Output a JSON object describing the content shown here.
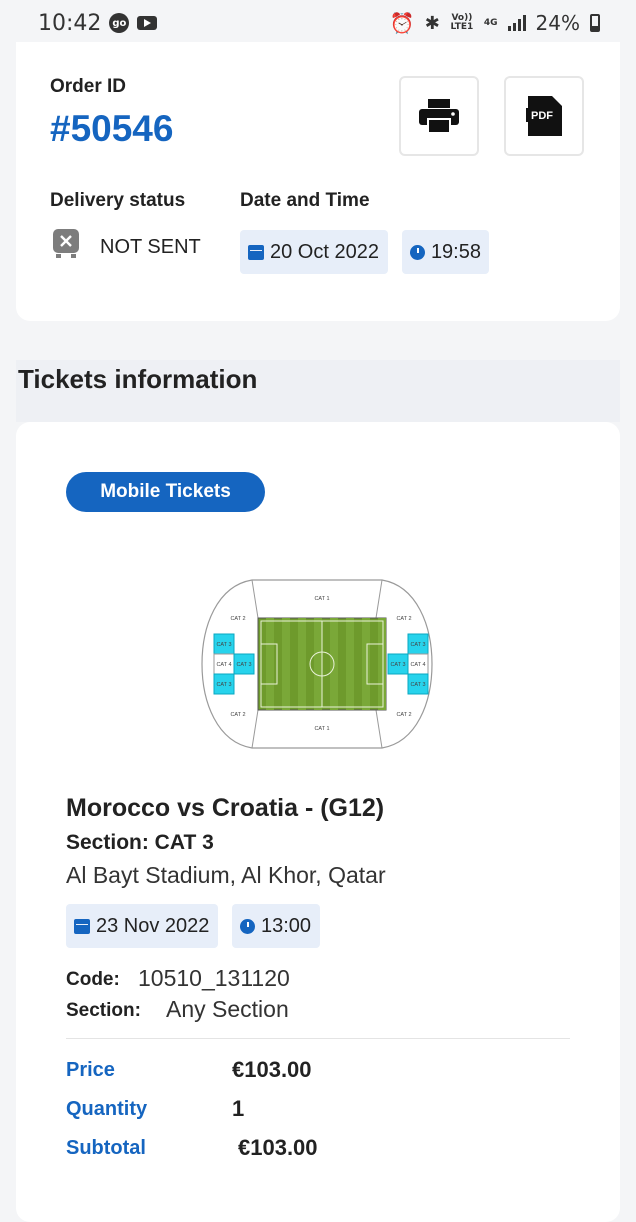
{
  "status_bar": {
    "time": "10:42",
    "app_badge": "go",
    "net_volte": "Vo)) LTE1",
    "net_4g": "4G",
    "battery": "24%"
  },
  "order": {
    "id_label": "Order ID",
    "id_value": "#50546",
    "print_icon": "print-icon",
    "pdf_icon": "pdf-icon",
    "pdf_text": "PDF",
    "delivery_label": "Delivery status",
    "delivery_value": "NOT SENT",
    "datetime_label": "Date and Time",
    "date": "20 Oct 2022",
    "time": "19:58"
  },
  "tickets": {
    "title": "Tickets information",
    "mobile_button": "Mobile Tickets",
    "stadium_labels": {
      "top": "CAT 1",
      "bottom": "CAT 1",
      "corner_tl": "CAT 2",
      "corner_tr": "CAT 2",
      "corner_bl": "CAT 2",
      "corner_br": "CAT 2",
      "left_top": "CAT 3",
      "left_mid_outer": "CAT 4",
      "left_mid_inner": "CAT 3",
      "left_bottom": "CAT 3",
      "right_top": "CAT 3",
      "right_mid_inner": "CAT 3",
      "right_mid_outer": "CAT 4",
      "right_bottom": "CAT 3"
    },
    "match_title": "Morocco vs Croatia - (G12)",
    "section_line": "Section: CAT 3",
    "venue": "Al Bayt Stadium, Al Khor, Qatar",
    "match_date": "23 Nov 2022",
    "match_time": "13:00",
    "code_label": "Code:",
    "code_value": "10510_131120",
    "section_label": "Section:",
    "section_value": "Any Section",
    "price_label": "Price",
    "price_value": "€103.00",
    "quantity_label": "Quantity",
    "quantity_value": "1",
    "subtotal_label": "Subtotal",
    "subtotal_value": "€103.00"
  },
  "colors": {
    "accent": "#1565c0",
    "pill_bg": "#e7eef9",
    "pitch": "#6e9a2c",
    "cat3_cyan": "#27d3ec"
  }
}
